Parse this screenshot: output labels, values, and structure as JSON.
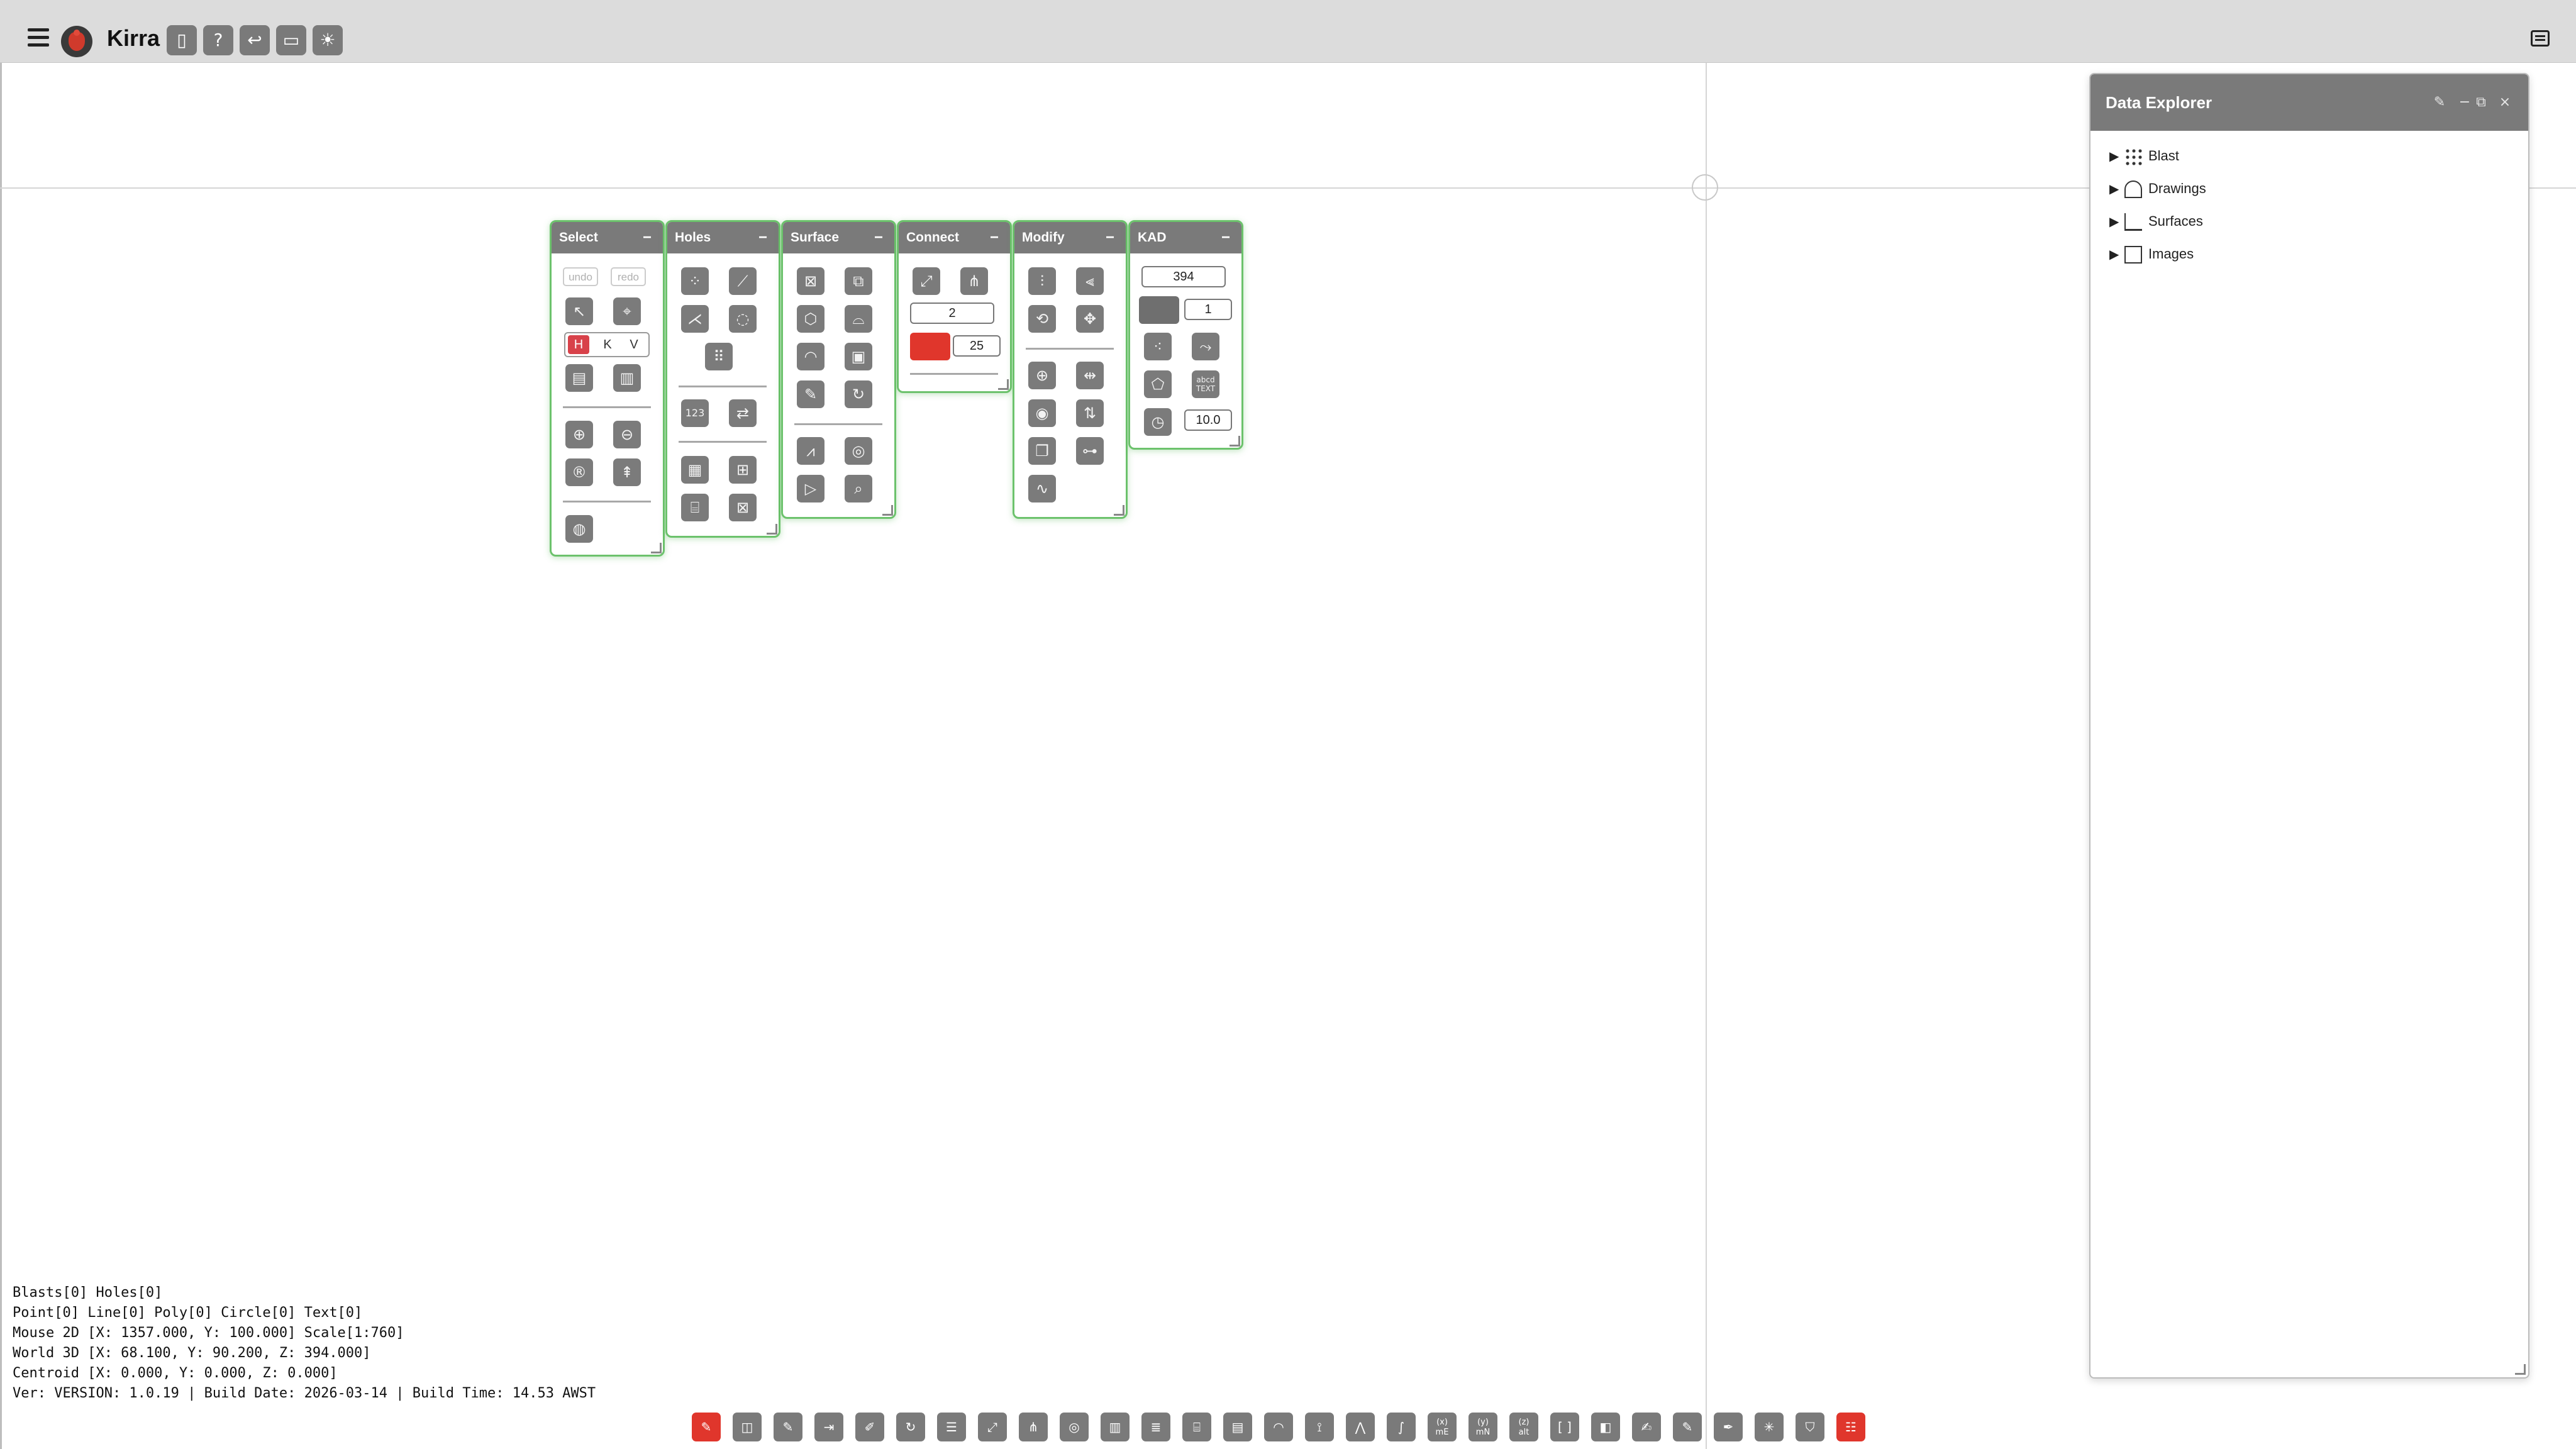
{
  "app": {
    "title": "Kirra"
  },
  "topbar": {
    "tools": [
      {
        "name": "book-icon",
        "glyph": "📖"
      },
      {
        "name": "help-icon",
        "glyph": "?"
      },
      {
        "name": "undo-icon",
        "glyph": "↩"
      },
      {
        "name": "display-icon",
        "glyph": "▭"
      },
      {
        "name": "theme-icon",
        "glyph": "☀"
      }
    ]
  },
  "panels": {
    "select": {
      "title": "Select",
      "min": "−",
      "undo": "undo",
      "redo": "redo",
      "h": "H",
      "k": "K",
      "v": "V"
    },
    "holes": {
      "title": "Holes",
      "min": "−"
    },
    "surface": {
      "title": "Surface",
      "min": "−"
    },
    "connect": {
      "title": "Connect",
      "min": "−",
      "value": "2",
      "size": "25",
      "color": "#e0362c"
    },
    "modify": {
      "title": "Modify",
      "min": "−"
    },
    "kad": {
      "title": "KAD",
      "min": "−",
      "elevation": "394",
      "lineWidth": "1",
      "radius": "10.0",
      "color": "#6f6f6f"
    }
  },
  "explorer": {
    "title": "Data Explorer",
    "items": [
      {
        "label": "Blast"
      },
      {
        "label": "Drawings"
      },
      {
        "label": "Surfaces"
      },
      {
        "label": "Images"
      }
    ]
  },
  "status": {
    "line1": "Blasts[0] Holes[0]",
    "line2": "Point[0] Line[0] Poly[0] Circle[0] Text[0]",
    "line3": "Mouse 2D [X: 1357.000, Y: 100.000] Scale[1:760]",
    "line4": "World 3D [X: 68.100, Y: 90.200, Z: 394.000]",
    "line5": "Centroid [X: 0.000, Y: 0.000, Z: 0.000]",
    "line6": "Ver: VERSION: 1.0.19 | Build Date: 2026-03-14 | Build Time: 14.53 AWST"
  },
  "bottomToolbar": {
    "labels": [
      "mE",
      "mN",
      "alt"
    ]
  },
  "colors": {
    "accent": "#6cc26c",
    "header": "#7a7a7a",
    "active": "#e0362c"
  }
}
